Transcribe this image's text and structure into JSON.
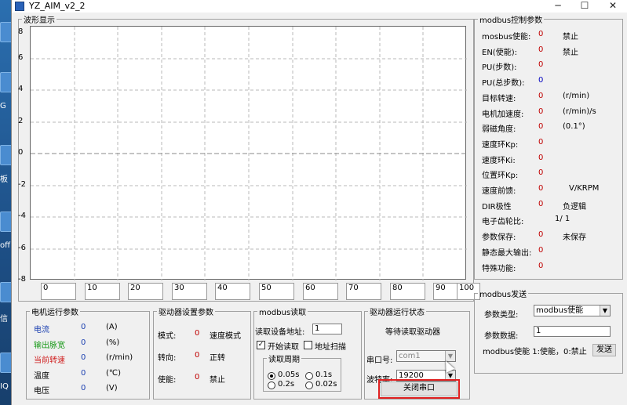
{
  "window": {
    "title": "YZ_AIM_v2_2",
    "minimize": "─",
    "maximize": "☐",
    "close": "✕"
  },
  "desktop": {
    "labels": [
      "G",
      "板",
      "off",
      "信",
      "IQ"
    ]
  },
  "wave": {
    "title": "波形显示",
    "yticks": [
      "8",
      "6",
      "4",
      "2",
      "0",
      "-2",
      "-4",
      "-6",
      "-8"
    ],
    "xticks": [
      "0",
      "10",
      "20",
      "30",
      "40",
      "50",
      "60",
      "70",
      "80",
      "90",
      "100"
    ]
  },
  "modbus_params": {
    "title": "modbus控制参数",
    "rows": [
      {
        "label": "mosbus使能:",
        "value": "0",
        "unit": "禁止",
        "value_color": "#c00000"
      },
      {
        "label": "EN(使能):",
        "value": "0",
        "unit": "禁止",
        "value_color": "#c00000"
      },
      {
        "label": "PU(步数):",
        "value": "0",
        "unit": "",
        "value_color": "#c00000"
      },
      {
        "label": "PU(总步数):",
        "value": "0",
        "unit": "",
        "value_color": "#0000c0"
      },
      {
        "label": "目标转速:",
        "value": "0",
        "unit": "(r/min)",
        "value_color": "#c00000"
      },
      {
        "label": "电机加速度:",
        "value": "0",
        "unit": "(r/min)/s",
        "value_color": "#c00000"
      },
      {
        "label": "弱磁角度:",
        "value": "0",
        "unit": "(0.1°)",
        "value_color": "#c00000"
      },
      {
        "label": "速度环Kp:",
        "value": "0",
        "unit": "",
        "value_color": "#c00000"
      },
      {
        "label": "速度环Ki:",
        "value": "0",
        "unit": "",
        "value_color": "#c00000"
      },
      {
        "label": "位置环Kp:",
        "value": "0",
        "unit": "",
        "value_color": "#c00000"
      },
      {
        "label": "速度前馈:",
        "value": "0",
        "unit": "V/KRPM",
        "value_color": "#c00000"
      },
      {
        "label": "DIR极性",
        "value": "0",
        "unit": "负逻辑",
        "value_color": "#c00000"
      },
      {
        "label": "电子齿轮比:",
        "value": "1/ 1",
        "unit": "",
        "value_color": "#000000"
      },
      {
        "label": "参数保存:",
        "value": "0",
        "unit": "未保存",
        "value_color": "#c00000"
      },
      {
        "label": "静态最大输出:",
        "value": "0",
        "unit": "",
        "value_color": "#c00000"
      },
      {
        "label": "特殊功能:",
        "value": "0",
        "unit": "",
        "value_color": "#c00000"
      }
    ]
  },
  "modbus_send": {
    "title": "modbus发送",
    "type_label": "参数类型:",
    "type_value": "modbus使能",
    "data_label": "参数数据:",
    "data_value": "1",
    "hint": "modbus使能 1:使能，0:禁止",
    "send_button": "发送"
  },
  "motor": {
    "title": "电机运行参数",
    "rows": [
      {
        "label": "电流",
        "value": "0",
        "unit": "(A)",
        "label_color": "#1a3fb0"
      },
      {
        "label": "输出脉宽",
        "value": "0",
        "unit": "(%)",
        "label_color": "#1a9a1a"
      },
      {
        "label": "当前转速",
        "value": "0",
        "unit": "(r/min)",
        "label_color": "#d02020"
      },
      {
        "label": "温度",
        "value": "0",
        "unit": "(℃)",
        "label_color": "#000000"
      },
      {
        "label": "电压",
        "value": "0",
        "unit": "(V)",
        "label_color": "#000000"
      }
    ]
  },
  "driver_settings": {
    "title": "驱动器设置参数",
    "rows": [
      {
        "label": "模式:",
        "value": "0",
        "unit": "速度模式"
      },
      {
        "label": "转向:",
        "value": "0",
        "unit": "正转"
      },
      {
        "label": "使能:",
        "value": "0",
        "unit": "禁止"
      }
    ]
  },
  "modbus_read": {
    "title": "modbus读取",
    "addr_label": "读取设备地址:",
    "addr_value": "1",
    "start_read": "开始读取",
    "start_read_checked": "✓",
    "addr_scan": "地址扫描",
    "period_title": "读取周期",
    "periods": [
      "0.05s",
      "0.1s",
      "0.2s",
      "0.02s"
    ]
  },
  "driver_status": {
    "title": "驱动器运行状态",
    "status": "等待读取驱动器",
    "port_label": "串口号:",
    "port_value": "com1",
    "baud_label": "波特率:",
    "baud_value": "19200",
    "close_port": "关闭串口"
  }
}
